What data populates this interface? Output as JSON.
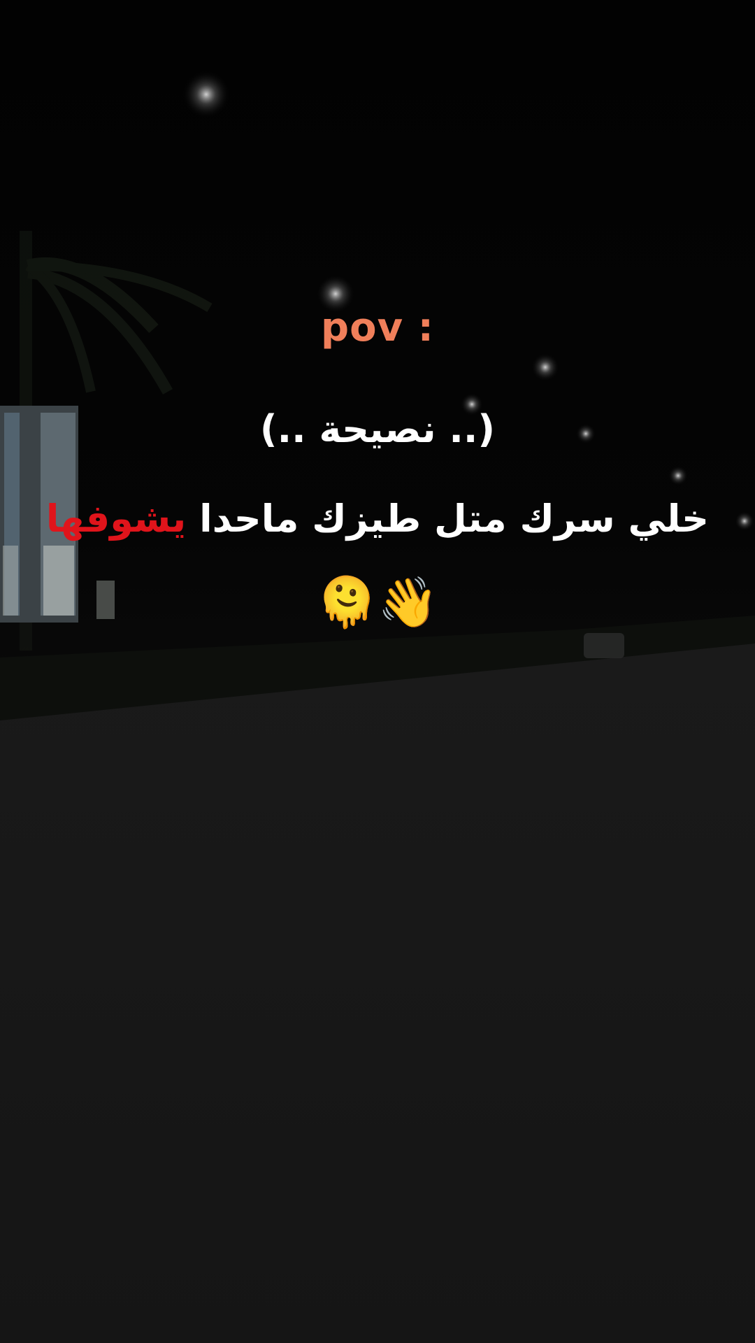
{
  "overlay": {
    "pov": "pov :",
    "advice": "(.. نصيحة ..)",
    "message": {
      "main": "خلي سرك متل طيزك ماحدا",
      "highlight": "يشوفها",
      "highlight_color": "#e0141b"
    },
    "emoji_icons": "🫠👋"
  },
  "colors": {
    "pov": "#f07f5a",
    "text": "#ffffff",
    "background": "#000000"
  }
}
